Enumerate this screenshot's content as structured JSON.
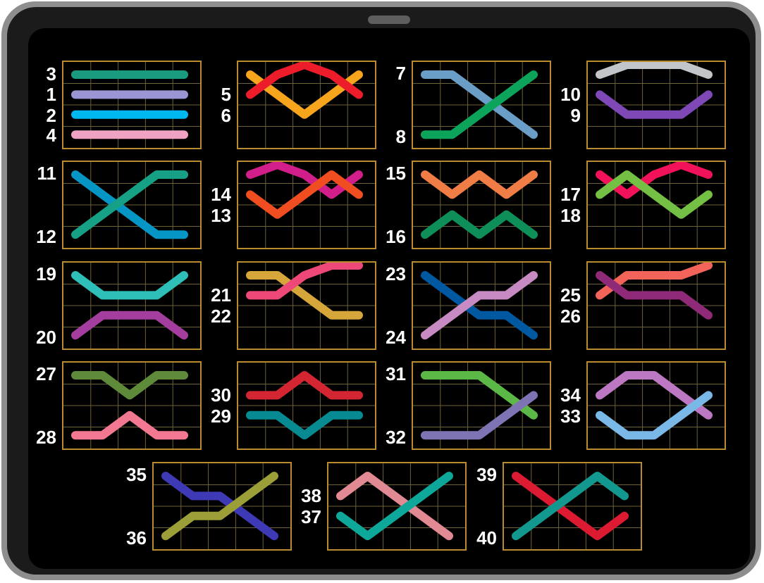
{
  "colors": {
    "grid_border": "#b98a2e",
    "grid_line": "#6e6238",
    "screen": "#000000",
    "bezel": "#1b1b1b",
    "frame": "#8e8e8e",
    "label": "#ffffff"
  },
  "paylines": [
    {
      "id": "3",
      "color": "#1a9a7e",
      "rows": [
        0,
        0,
        0,
        0,
        0
      ]
    },
    {
      "id": "1",
      "color": "#9a96d4",
      "rows": [
        1,
        1,
        1,
        1,
        1
      ]
    },
    {
      "id": "2",
      "color": "#00b8f0",
      "rows": [
        2,
        2,
        2,
        2,
        2
      ]
    },
    {
      "id": "4",
      "color": "#efa2c2",
      "rows": [
        3,
        3,
        3,
        3,
        3
      ]
    },
    {
      "id": "5",
      "color": "#f8a51e",
      "rows": [
        0,
        1,
        2,
        1,
        0
      ]
    },
    {
      "id": "6",
      "color": "#ec1c2a",
      "rows": [
        1,
        0,
        -1,
        0,
        1
      ]
    },
    {
      "id": "7",
      "color": "#6a9ec6",
      "rows": [
        0,
        0,
        1,
        2,
        3
      ]
    },
    {
      "id": "8",
      "color": "#0ca45a",
      "rows": [
        3,
        3,
        2,
        1,
        0
      ]
    },
    {
      "id": "10",
      "color": "#c2c6c8",
      "rows": [
        0,
        -1,
        -1,
        -1,
        0
      ]
    },
    {
      "id": "9",
      "color": "#7e48b6",
      "rows": [
        1,
        2,
        2,
        2,
        1
      ]
    },
    {
      "id": "11",
      "color": "#0696c6",
      "rows": [
        0,
        1,
        2,
        3,
        3
      ]
    },
    {
      "id": "12",
      "color": "#16a086",
      "rows": [
        3,
        2,
        1,
        0,
        0
      ]
    },
    {
      "id": "14",
      "color": "#d21e8a",
      "rows": [
        0,
        -1,
        0,
        1,
        0
      ]
    },
    {
      "id": "13",
      "color": "#f04e20",
      "rows": [
        1,
        2,
        1,
        0,
        1
      ]
    },
    {
      "id": "15",
      "color": "#f07c46",
      "rows": [
        0,
        1,
        0,
        1,
        0
      ]
    },
    {
      "id": "16",
      "color": "#0e8e58",
      "rows": [
        3,
        2,
        3,
        2,
        3
      ]
    },
    {
      "id": "17",
      "color": "#f2125a",
      "rows": [
        0,
        1,
        0,
        -1,
        0
      ]
    },
    {
      "id": "18",
      "color": "#74c044",
      "rows": [
        1,
        0,
        1,
        2,
        1
      ]
    },
    {
      "id": "19",
      "color": "#2ec0b8",
      "rows": [
        0,
        1,
        1,
        1,
        0
      ]
    },
    {
      "id": "20",
      "color": "#a43e9e",
      "rows": [
        3,
        2,
        2,
        2,
        3
      ]
    },
    {
      "id": "21",
      "color": "#d6a63a",
      "rows": [
        0,
        0,
        1,
        2,
        2
      ]
    },
    {
      "id": "22",
      "color": "#ee4878",
      "rows": [
        1,
        1,
        0,
        -1,
        -1
      ]
    },
    {
      "id": "23",
      "color": "#0058a0",
      "rows": [
        0,
        1,
        2,
        2,
        3
      ]
    },
    {
      "id": "24",
      "color": "#c88ac2",
      "rows": [
        3,
        2,
        1,
        1,
        0
      ]
    },
    {
      "id": "25",
      "color": "#f2645a",
      "rows": [
        1,
        0,
        0,
        0,
        -1
      ]
    },
    {
      "id": "26",
      "color": "#8e2a78",
      "rows": [
        0,
        1,
        1,
        1,
        2
      ]
    },
    {
      "id": "27",
      "color": "#5e8a3a",
      "rows": [
        0,
        0,
        1,
        0,
        0
      ]
    },
    {
      "id": "28",
      "color": "#f27892",
      "rows": [
        3,
        3,
        2,
        3,
        3
      ]
    },
    {
      "id": "30",
      "color": "#d42632",
      "rows": [
        1,
        1,
        0,
        1,
        1
      ]
    },
    {
      "id": "29",
      "color": "#078a92",
      "rows": [
        2,
        2,
        3,
        2,
        2
      ]
    },
    {
      "id": "31",
      "color": "#5cb846",
      "rows": [
        0,
        0,
        0,
        1,
        2
      ]
    },
    {
      "id": "32",
      "color": "#7e74b4",
      "rows": [
        3,
        3,
        3,
        2,
        1
      ]
    },
    {
      "id": "34",
      "color": "#bc78c2",
      "rows": [
        1,
        0,
        0,
        1,
        2
      ]
    },
    {
      "id": "33",
      "color": "#7ab8e8",
      "rows": [
        2,
        3,
        3,
        2,
        1
      ]
    },
    {
      "id": "35",
      "color": "#3e3ab6",
      "rows": [
        0,
        1,
        1,
        2,
        3
      ]
    },
    {
      "id": "36",
      "color": "#9c9e38",
      "rows": [
        3,
        2,
        2,
        1,
        0
      ]
    },
    {
      "id": "38",
      "color": "#e28a94",
      "rows": [
        1,
        0,
        1,
        2,
        3
      ]
    },
    {
      "id": "37",
      "color": "#0ea89a",
      "rows": [
        2,
        3,
        2,
        1,
        0
      ]
    },
    {
      "id": "39",
      "color": "#dc1a32",
      "rows": [
        0,
        1,
        2,
        3,
        2
      ]
    },
    {
      "id": "40",
      "color": "#12988e",
      "rows": [
        3,
        2,
        1,
        0,
        1
      ]
    }
  ],
  "panels": [
    {
      "lines": [
        0,
        1,
        2,
        3
      ],
      "labels": [
        "3",
        "1",
        "2",
        "4"
      ]
    },
    {
      "lines": [
        4,
        5
      ],
      "labels": [
        "5",
        "6"
      ]
    },
    {
      "lines": [
        6,
        7
      ],
      "labels": [
        "7",
        "8"
      ]
    },
    {
      "lines": [
        8,
        9
      ],
      "labels": [
        "10",
        "9"
      ]
    },
    {
      "lines": [
        10,
        11
      ],
      "labels": [
        "11",
        "12"
      ]
    },
    {
      "lines": [
        12,
        13
      ],
      "labels": [
        "14",
        "13"
      ]
    },
    {
      "lines": [
        14,
        15
      ],
      "labels": [
        "15",
        "16"
      ]
    },
    {
      "lines": [
        16,
        17
      ],
      "labels": [
        "17",
        "18"
      ]
    },
    {
      "lines": [
        18,
        19
      ],
      "labels": [
        "19",
        "20"
      ]
    },
    {
      "lines": [
        20,
        21
      ],
      "labels": [
        "21",
        "22"
      ]
    },
    {
      "lines": [
        22,
        23
      ],
      "labels": [
        "23",
        "24"
      ]
    },
    {
      "lines": [
        24,
        25
      ],
      "labels": [
        "25",
        "26"
      ]
    },
    {
      "lines": [
        26,
        27
      ],
      "labels": [
        "27",
        "28"
      ]
    },
    {
      "lines": [
        28,
        29
      ],
      "labels": [
        "30",
        "29"
      ]
    },
    {
      "lines": [
        30,
        31
      ],
      "labels": [
        "31",
        "32"
      ]
    },
    {
      "lines": [
        32,
        33
      ],
      "labels": [
        "34",
        "33"
      ]
    },
    {
      "lines": [
        34,
        35
      ],
      "labels": [
        "35",
        "36"
      ]
    },
    {
      "lines": [
        36,
        37
      ],
      "labels": [
        "38",
        "37"
      ]
    },
    {
      "lines": [
        38,
        39
      ],
      "labels": [
        "39",
        "40"
      ]
    }
  ]
}
